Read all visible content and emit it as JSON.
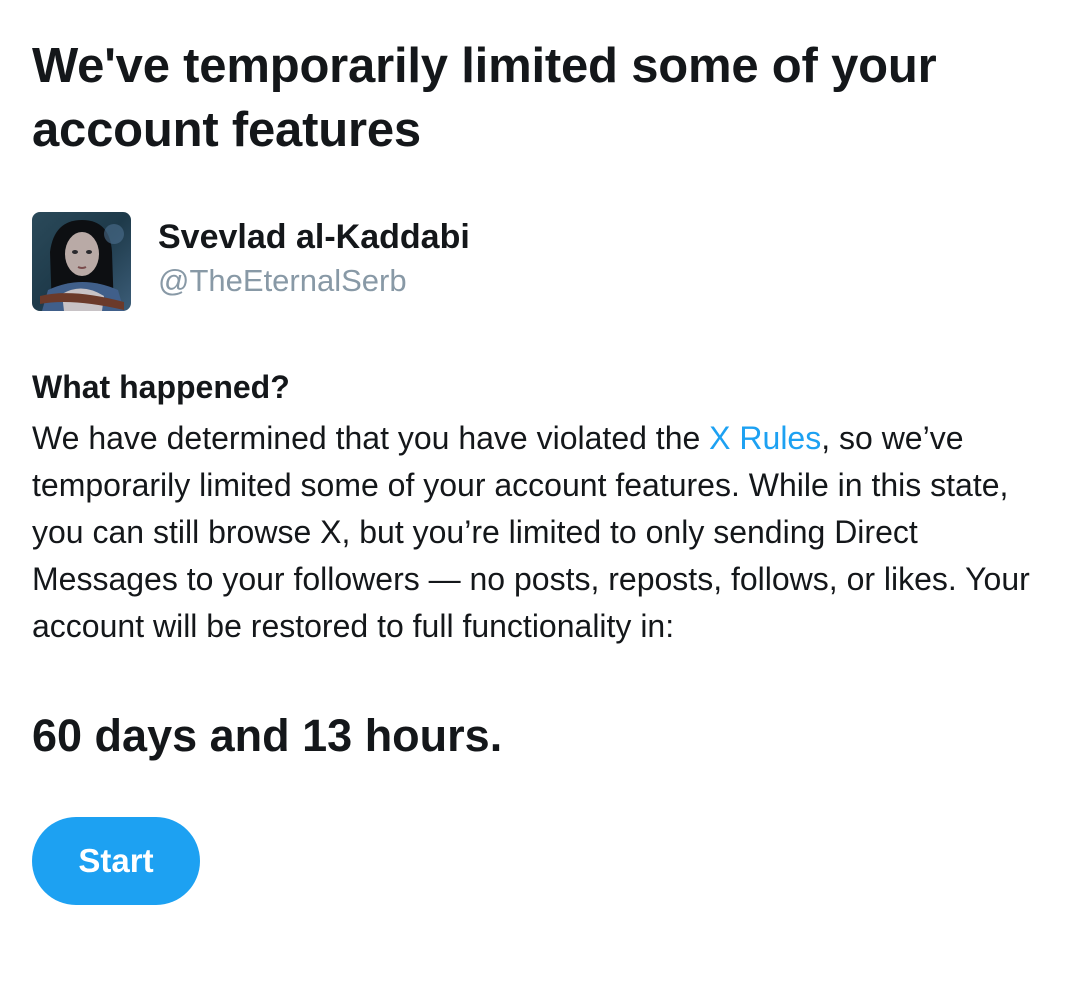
{
  "header": {
    "title": "We've temporarily limited some of your account features"
  },
  "account": {
    "display_name": "Svevlad al-Kaddabi",
    "handle": "@TheEternalSerb"
  },
  "notice": {
    "heading": "What happened?",
    "text_before_link": "We have determined that you have violated the ",
    "link_label": "X Rules",
    "text_after_link": ", so we’ve temporarily limited some of your account features. While in this state, you can still browse X, but you’re limited to only sending Direct Messages to your followers — no posts, reposts, follows, or likes. Your account will be restored to full functionality in:",
    "duration": "60 days and 13 hours."
  },
  "actions": {
    "start_label": "Start"
  },
  "colors": {
    "accent": "#1da1f2",
    "text": "#14171a",
    "muted": "#8899a6"
  }
}
